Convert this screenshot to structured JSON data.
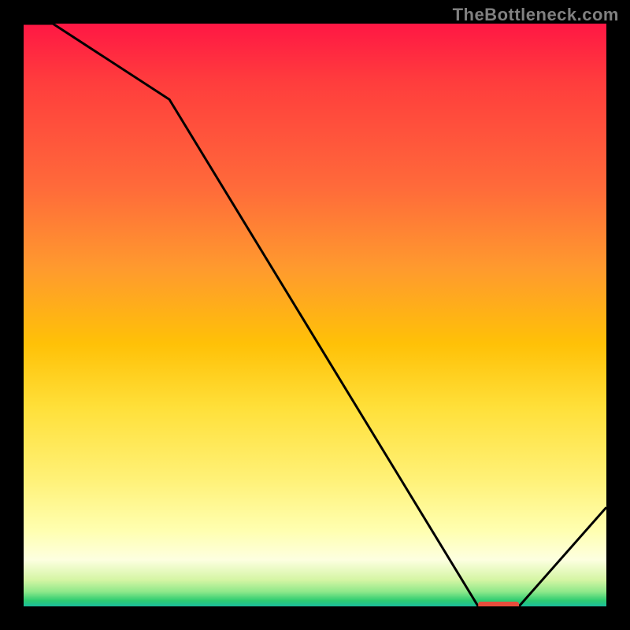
{
  "attribution": "TheBottleneck.com",
  "chart_data": {
    "type": "line",
    "title": "",
    "xlabel": "",
    "ylabel": "",
    "x": [
      0.0,
      0.05,
      0.25,
      0.78,
      0.85,
      1.0
    ],
    "values": [
      1.0,
      1.0,
      0.87,
      0.0,
      0.0,
      0.17
    ],
    "marker": {
      "x_start": 0.78,
      "x_end": 0.85,
      "y": 0.0
    },
    "xlim": [
      0,
      1
    ],
    "ylim": [
      0,
      1
    ],
    "gradient_bands": [
      {
        "color": "#ff1744",
        "stop": 0.0
      },
      {
        "color": "#ff3d3d",
        "stop": 0.1
      },
      {
        "color": "#ff6a3a",
        "stop": 0.28
      },
      {
        "color": "#ff9a2e",
        "stop": 0.42
      },
      {
        "color": "#ffc107",
        "stop": 0.55
      },
      {
        "color": "#ffe03a",
        "stop": 0.66
      },
      {
        "color": "#fff176",
        "stop": 0.78
      },
      {
        "color": "#ffffb0",
        "stop": 0.87
      },
      {
        "color": "#fdffe0",
        "stop": 0.92
      },
      {
        "color": "#d4f5a3",
        "stop": 0.955
      },
      {
        "color": "#8ee88a",
        "stop": 0.975
      },
      {
        "color": "#2ecc71",
        "stop": 0.99
      },
      {
        "color": "#1abc9c",
        "stop": 1.0
      }
    ]
  }
}
